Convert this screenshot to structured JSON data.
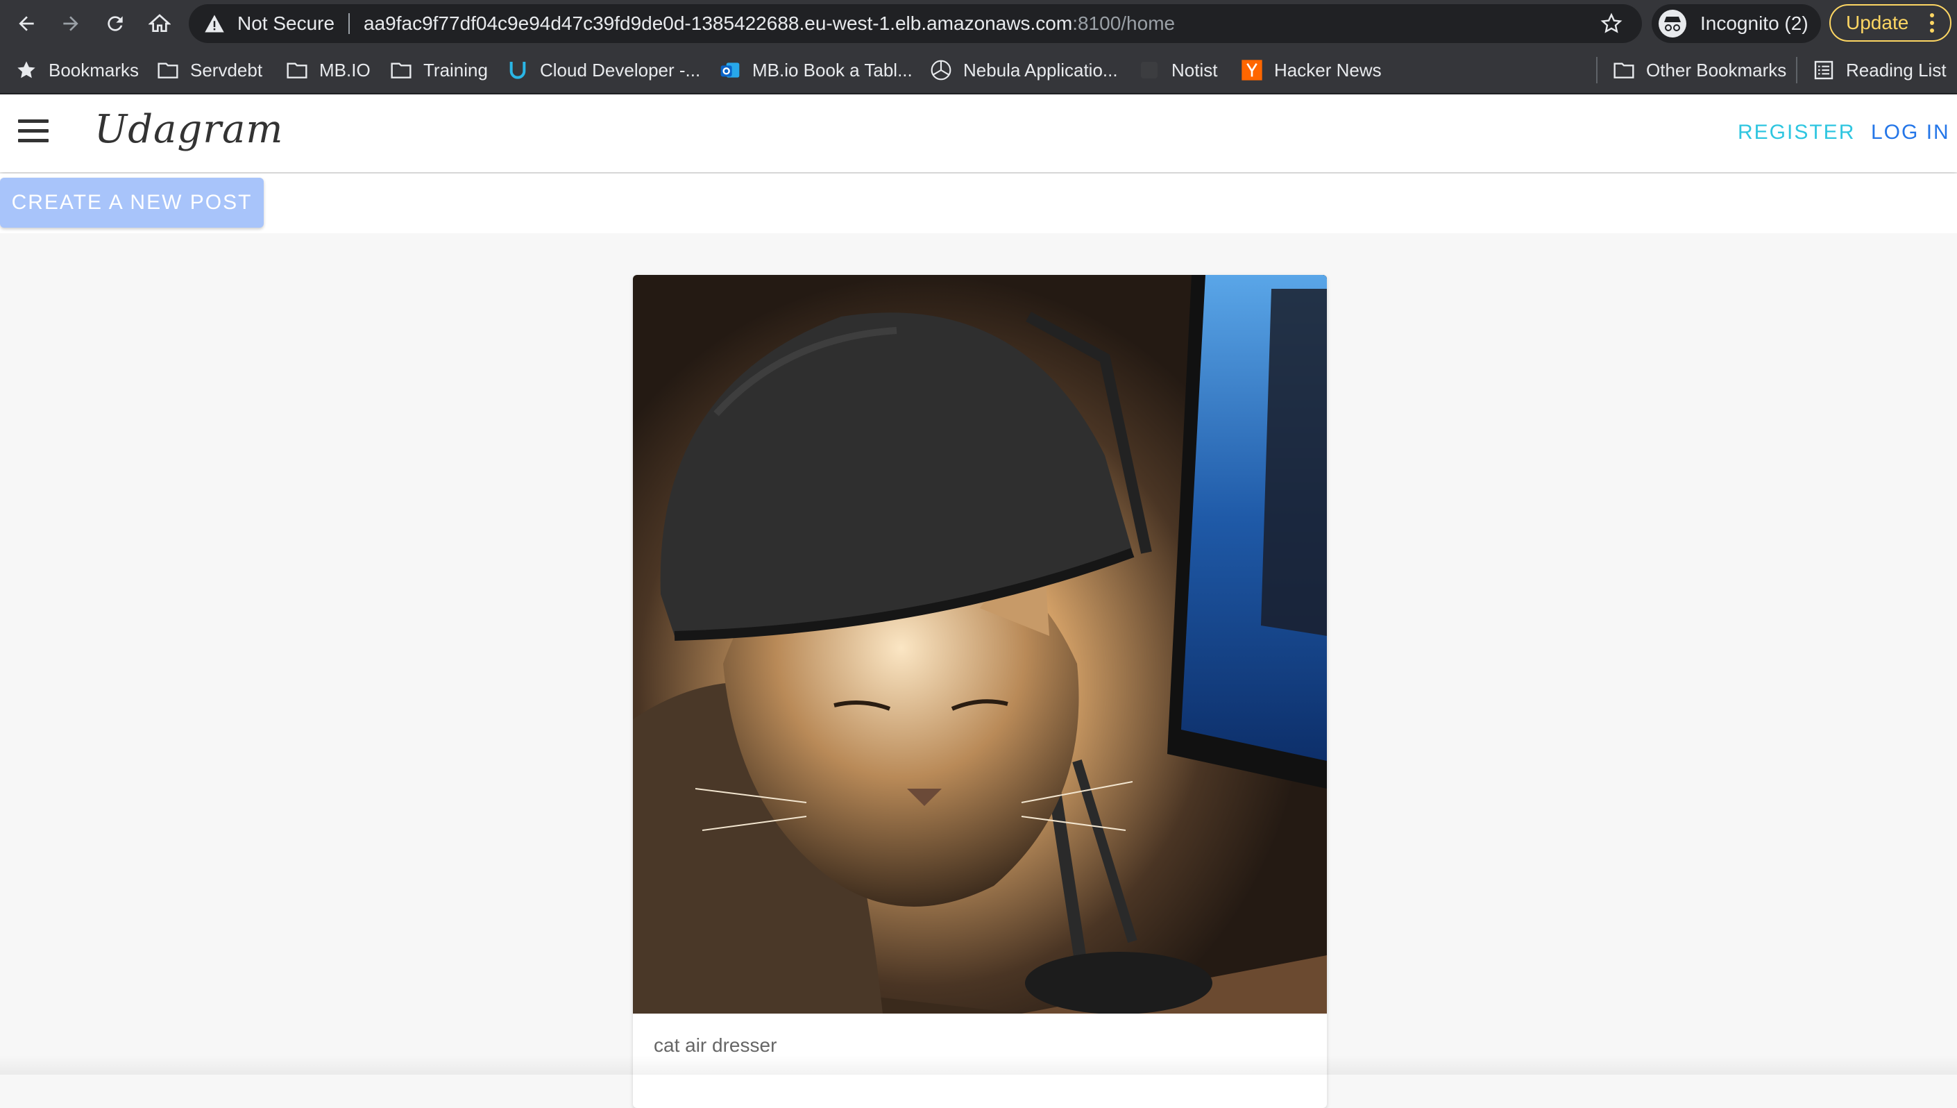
{
  "browser": {
    "security_label": "Not Secure",
    "url_host": "aa9fac9f77df04c9e94d47c39fd9de0d-1385422688.eu-west-1.elb.amazonaws.com",
    "url_rest": ":8100/home",
    "incognito_label": "Incognito (2)",
    "update_label": "Update",
    "bookmarks": [
      {
        "label": "Bookmarks",
        "icon": "star-icon"
      },
      {
        "label": "Servdebt",
        "icon": "folder-icon"
      },
      {
        "label": "MB.IO",
        "icon": "folder-icon"
      },
      {
        "label": "Training",
        "icon": "folder-icon"
      },
      {
        "label": "Cloud Developer -...",
        "icon": "udacity-icon"
      },
      {
        "label": "MB.io Book a Tabl...",
        "icon": "outlook-icon"
      },
      {
        "label": "Nebula Applicatio...",
        "icon": "mercedes-icon"
      },
      {
        "label": "Notist",
        "icon": "notist-icon"
      },
      {
        "label": "Hacker News",
        "icon": "hacker-news-icon"
      }
    ],
    "bookmarks_right": [
      {
        "label": "Other Bookmarks",
        "icon": "folder-icon"
      },
      {
        "label": "Reading List",
        "icon": "reading-list-icon"
      }
    ]
  },
  "app": {
    "brand": "Udagram",
    "nav": {
      "register": "REGISTER",
      "login": "LOG IN"
    },
    "create_post_label": "CREATE A NEW POST",
    "feed": [
      {
        "caption": "cat air dresser",
        "image": "cat-under-lamp-photo"
      }
    ]
  },
  "colors": {
    "register": "#2fc6e0",
    "login": "#2476e8",
    "create_button": "#a8c4fa",
    "update_accent": "#fdd663"
  }
}
